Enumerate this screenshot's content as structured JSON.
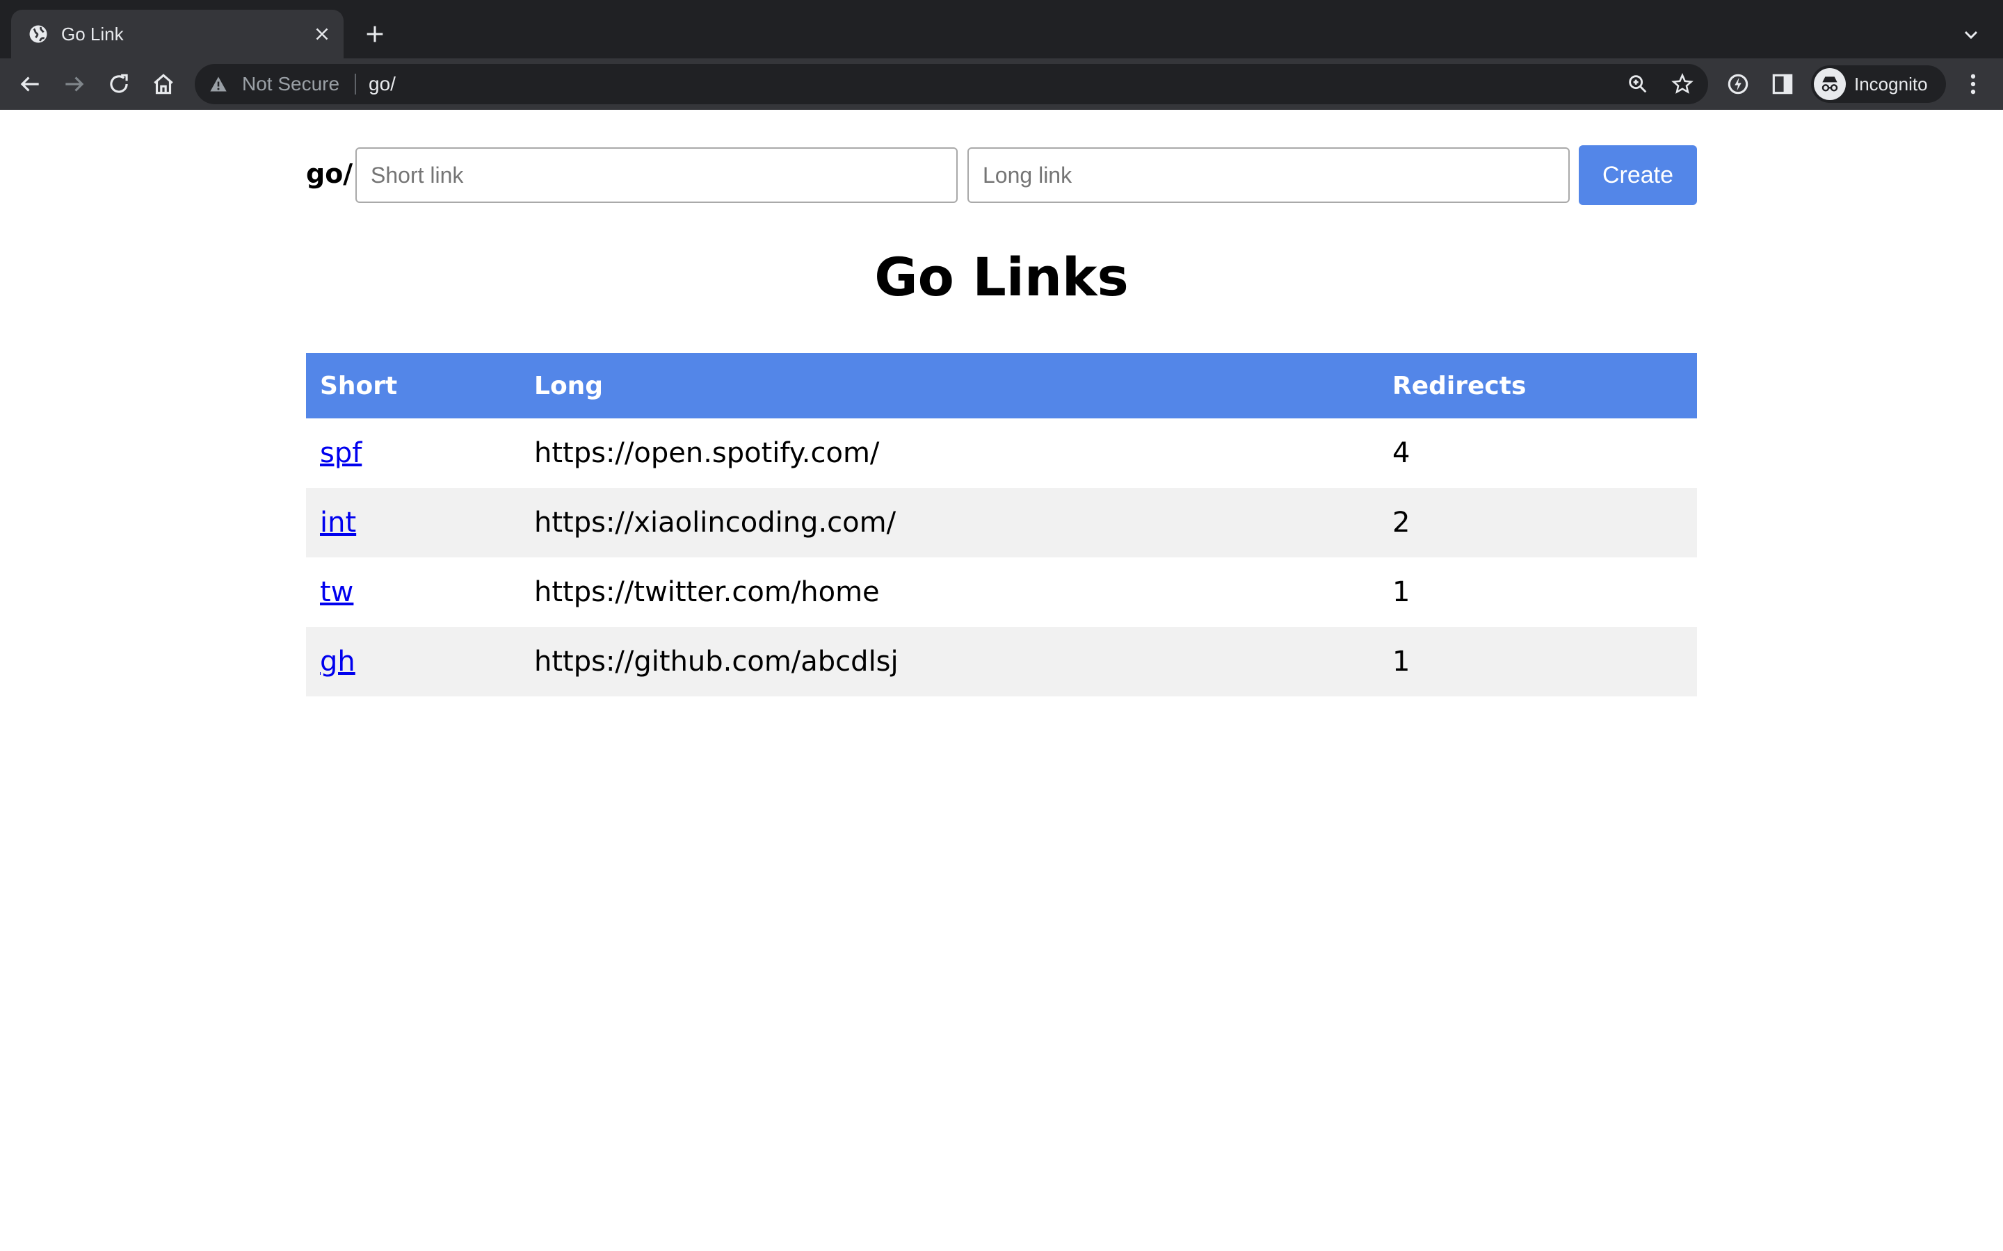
{
  "browser": {
    "tab_title": "Go Link",
    "security_label": "Not Secure",
    "url": "go/",
    "profile_label": "Incognito",
    "icons": [
      "globe-icon",
      "close-icon",
      "plus-icon",
      "chevron-down-icon",
      "back-icon",
      "forward-icon",
      "reload-icon",
      "home-icon",
      "warning-icon",
      "zoom-icon",
      "star-icon",
      "extension-icon",
      "side-panel-icon",
      "incognito-icon",
      "menu-icon"
    ]
  },
  "form": {
    "prefix": "go/",
    "short_placeholder": "Short link",
    "long_placeholder": "Long link",
    "create_label": "Create"
  },
  "title": "Go Links",
  "table": {
    "headers": [
      "Short",
      "Long",
      "Redirects"
    ],
    "rows": [
      {
        "short": "spf",
        "long": "https://open.spotify.com/",
        "redirects": "4"
      },
      {
        "short": "int",
        "long": "https://xiaolincoding.com/",
        "redirects": "2"
      },
      {
        "short": "tw",
        "long": "https://twitter.com/home",
        "redirects": "1"
      },
      {
        "short": "gh",
        "long": "https://github.com/abcdlsj",
        "redirects": "1"
      }
    ]
  },
  "colors": {
    "accent": "#5386e8",
    "link": "#0000ee",
    "row_alt": "#f1f1f1",
    "chrome_dark": "#202124",
    "chrome_toolbar": "#35363a"
  }
}
